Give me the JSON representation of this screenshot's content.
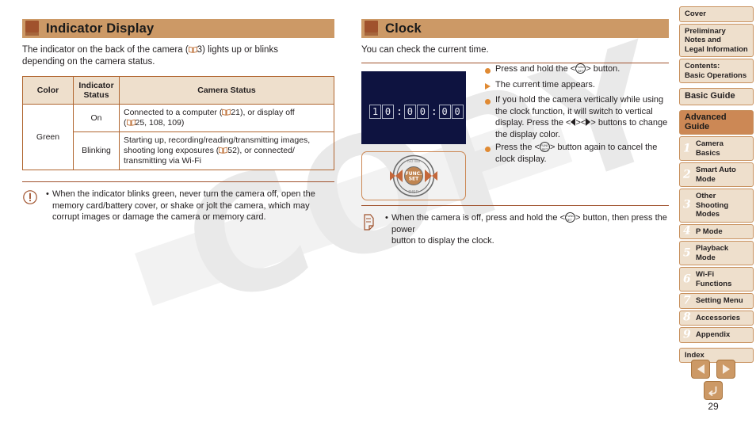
{
  "document": {
    "page_number": "29",
    "watermark": "COPY"
  },
  "left_column": {
    "heading": "Indicator Display",
    "intro_part1": "The indicator on the back of the camera (",
    "intro_ref": "3) lights up or blinks",
    "intro_part2": "depending on the camera status.",
    "table": {
      "headers": [
        "Color",
        "Indicator Status",
        "Camera Status"
      ],
      "rows": [
        {
          "color": "Green",
          "state": "On",
          "desc_line1_a": "Connected to a computer (",
          "desc_line1_b": "21), or display off",
          "desc_line2_b": "25, 108, 109)"
        },
        {
          "color": "",
          "state": "Blinking",
          "desc_line1": "Starting up, recording/reading/transmitting images,",
          "desc_line2_a": "shooting long exposures (",
          "desc_line2_b": "52), or connected/",
          "desc_line3": "transmitting via Wi-Fi"
        }
      ]
    },
    "caution": {
      "icon": "caution-icon",
      "line1": "When the indicator blinks green, never turn the camera off, open the",
      "line2": "memory card/battery cover, or shake or jolt the camera, which may",
      "line3": "corrupt images or damage the camera or memory card."
    }
  },
  "right_column": {
    "heading": "Clock",
    "intro": "You can check the current time.",
    "lcd": {
      "digits": [
        "1",
        "0",
        "0",
        "0",
        "0",
        "0"
      ],
      "separators": [
        ":",
        ":"
      ]
    },
    "dial_labels": {
      "func_set_top": "FUNC.",
      "func_set_bottom": "SET",
      "disp": "DISP.",
      "top_left": "ISO",
      "top_right": "WB"
    },
    "steps": [
      {
        "mark": "dot",
        "text_a": "Press and hold the <",
        "text_b": "> button."
      },
      {
        "mark": "triangle",
        "text_a": "The current time appears.",
        "text_b": ""
      },
      {
        "mark": "dot",
        "text_a": "If you hold the camera vertically while using the clock function, it will switch to vertical display. Press the <",
        "text_b": "><",
        "text_c": "> buttons to change the display color."
      },
      {
        "mark": "dot",
        "text_a": "Press the <",
        "text_b": "> button again to cancel the clock display."
      }
    ],
    "note": {
      "icon": "pencil-note-icon",
      "line1_a": "When the camera is off, press and hold the <",
      "line1_b": "> button, then press the power",
      "line2": "button to display the clock."
    }
  },
  "sidebar": {
    "items": [
      {
        "label": "Cover",
        "num": "",
        "style": "plain"
      },
      {
        "label": "Preliminary Notes and Legal Information",
        "num": "",
        "style": "plain"
      },
      {
        "label": "Contents: Basic Operations",
        "num": "",
        "style": "plain"
      },
      {
        "label": "Basic Guide",
        "num": "",
        "style": "big"
      },
      {
        "label": "Advanced Guide",
        "num": "",
        "style": "accent"
      },
      {
        "label": "Camera Basics",
        "num": "1",
        "style": "chapter"
      },
      {
        "label": "Smart Auto Mode",
        "num": "2",
        "style": "chapter"
      },
      {
        "label": "Other Shooting Modes",
        "num": "3",
        "style": "chapter"
      },
      {
        "label": "P Mode",
        "num": "4",
        "style": "chapter"
      },
      {
        "label": "Playback Mode",
        "num": "5",
        "style": "chapter"
      },
      {
        "label": "Wi-Fi Functions",
        "num": "6",
        "style": "chapter"
      },
      {
        "label": "Setting Menu",
        "num": "7",
        "style": "chapter"
      },
      {
        "label": "Accessories",
        "num": "8",
        "style": "chapter"
      },
      {
        "label": "Appendix",
        "num": "9",
        "style": "chapter"
      },
      {
        "label": "Index",
        "num": "",
        "style": "plain"
      }
    ]
  },
  "bottom_nav": {
    "prev_icon": "triangle-left-icon",
    "next_icon": "triangle-right-icon",
    "back_icon": "return-arrow-icon"
  },
  "colors": {
    "header_bar": "#cc9966",
    "header_tab": "#a0522d",
    "table_header": "#eedfcc",
    "table_border": "#b0652f",
    "accent": "#cc8855",
    "bullet": "#e08a33",
    "lcd_bg": "#0e1340",
    "watermark": "#e9e9e9"
  }
}
